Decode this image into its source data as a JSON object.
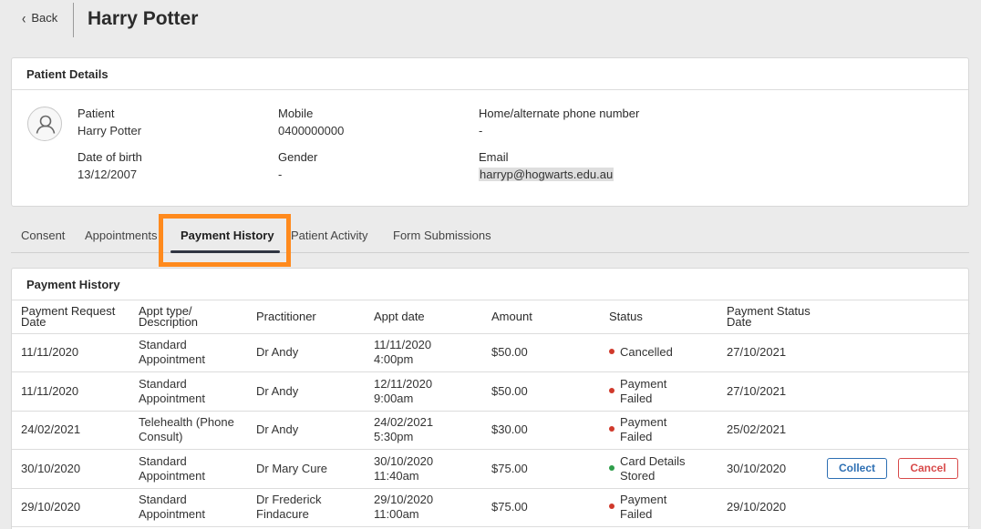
{
  "header": {
    "back_label": "Back",
    "title": "Harry Potter"
  },
  "patient_details": {
    "card_title": "Patient Details",
    "patient_label": "Patient",
    "patient_value": "Harry Potter",
    "mobile_label": "Mobile",
    "mobile_value": "0400000000",
    "home_phone_label": "Home/alternate phone number",
    "home_phone_value": "-",
    "dob_label": "Date of birth",
    "dob_value": "13/12/2007",
    "gender_label": "Gender",
    "gender_value": "-",
    "email_label": "Email",
    "email_value": "harryp@hogwarts.edu.au"
  },
  "tabs": [
    {
      "label": "Consent"
    },
    {
      "label": "Appointments"
    },
    {
      "label": "Payment History",
      "active": true
    },
    {
      "label": "Patient Activity"
    },
    {
      "label": "Form Submissions"
    }
  ],
  "payment_history": {
    "card_title": "Payment History",
    "columns": [
      "Payment Request Date",
      "Appt type/ Description",
      "Practitioner",
      "Appt date",
      "Amount",
      "Status",
      "Payment Status Date"
    ],
    "collect_label": "Collect",
    "cancel_label": "Cancel",
    "status_colors": {
      "red": "#d0392b",
      "green": "#2e9e4a"
    },
    "rows": [
      {
        "request_date": "11/11/2020",
        "appt_type": "Standard Appointment",
        "practitioner": "Dr Andy",
        "appt_date": "11/11/2020",
        "appt_time": "4:00pm",
        "amount": "$50.00",
        "status": "Cancelled",
        "status_color": "red",
        "status_date": "27/10/2021"
      },
      {
        "request_date": "11/11/2020",
        "appt_type": "Standard Appointment",
        "practitioner": "Dr Andy",
        "appt_date": "12/11/2020",
        "appt_time": "9:00am",
        "amount": "$50.00",
        "status": "Payment Failed",
        "status_color": "red",
        "status_date": "27/10/2021"
      },
      {
        "request_date": "24/02/2021",
        "appt_type": "Telehealth (Phone Consult)",
        "practitioner": "Dr Andy",
        "appt_date": "24/02/2021",
        "appt_time": "5:30pm",
        "amount": "$30.00",
        "status": "Payment Failed",
        "status_color": "red",
        "status_date": "25/02/2021"
      },
      {
        "request_date": "30/10/2020",
        "appt_type": "Standard Appointment",
        "practitioner": "Dr Mary Cure",
        "appt_date": "30/10/2020",
        "appt_time": "11:40am",
        "amount": "$75.00",
        "status": "Card Details Stored",
        "status_color": "green",
        "status_date": "30/10/2020",
        "actions": true
      },
      {
        "request_date": "29/10/2020",
        "appt_type": "Standard Appointment",
        "practitioner": "Dr Frederick Findacure",
        "appt_date": "29/10/2020",
        "appt_time": "11:00am",
        "amount": "$75.00",
        "status": "Payment Failed",
        "status_color": "red",
        "status_date": "29/10/2020"
      }
    ]
  }
}
